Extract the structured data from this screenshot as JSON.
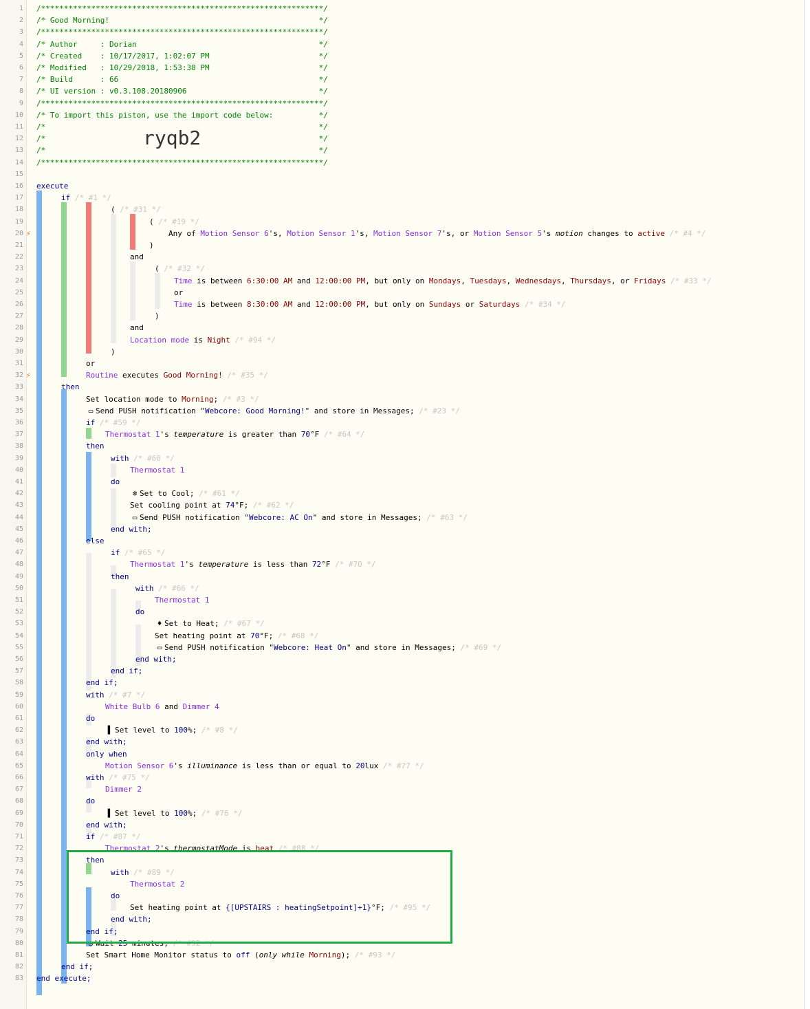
{
  "header": [
    "/**************************************************************/",
    "/* Good Morning!                                              */",
    "/**************************************************************/",
    "/* Author     : Dorian                                        */",
    "/* Created    : 10/17/2017, 1:02:07 PM                        */",
    "/* Modified   : 10/29/2018, 1:53:38 PM                        */",
    "/* Build      : 66                                            */",
    "/* UI version : v0.3.108.20180906                             */",
    "/**************************************************************/",
    "/* To import this piston, use the import code below:          */",
    "/*                                                            */",
    "/*                                                            */",
    "/*                                                            */",
    "/**************************************************************/"
  ],
  "import_code": "ryqb2",
  "code": {
    "execute": "execute",
    "if": "if",
    "c1": "/* #1 */",
    "c31": "/* #31 */",
    "c19": "/* #19 */",
    "line20_pre": "Any of ",
    "ms6": "Motion Sensor 6",
    "s_comma": "'s, ",
    "ms1": "Motion Sensor 1",
    "ms7": "Motion Sensor 7",
    "or_text": "'s, or ",
    "ms5": "Motion Sensor 5",
    "s_text": "'s ",
    "motion": "motion",
    "changes_to": " changes to ",
    "active": "active",
    "c4": "/* #4 */",
    "and": "and",
    "c32": "/* #32 */",
    "time": "Time",
    "is_between": " is between ",
    "t1": "6:30:00 AM",
    "and_sp": " and ",
    "t2": "12:00:00 PM",
    "but_only": ", but only on ",
    "mondays": "Mondays",
    "comma": ", ",
    "tuesdays": "Tuesdays",
    "wednesdays": "Wednesdays",
    "thursdays": "Thursdays",
    "comma_or": ", or ",
    "fridays": "Fridays",
    "c33": "/* #33 */",
    "or": "or",
    "t3": "8:30:00 AM",
    "sundays": "Sundays",
    "or_sp": " or ",
    "saturdays": "Saturdays",
    "c34": "/* #34 */",
    "location_mode": "Location mode",
    "is": " is ",
    "night": "Night",
    "c94": "/* #94 */",
    "routine": "Routine",
    "executes": " executes ",
    "good_morning": "Good Morning!",
    "c35": "/* #35 */",
    "then": "then",
    "set_loc_mode": "Set location mode to ",
    "morning": "Morning",
    "semi": ";",
    "c3": "/* #3 */",
    "send_push": "Send PUSH notification \"",
    "msg_gm": "Webcore: Good Morning!",
    "store": "\" and store in Messages;",
    "c23": "/* #23 */",
    "c59": "/* #59 */",
    "thermo1": "Thermostat 1",
    "temperature": "temperature",
    "greater": " is greater than ",
    "v70": "70",
    "degF": "°F",
    "c64": "/* #64 */",
    "with": "with",
    "c60": "/* #60 */",
    "do": "do",
    "set_cool": "Set to Cool;",
    "c61": "/* #61 */",
    "set_cool_pt": "Set cooling point at ",
    "v74": "74",
    "degF_semi": "°F;",
    "c62": "/* #62 */",
    "msg_ac": "Webcore: AC On",
    "c63": "/* #63 */",
    "end_with": "end with;",
    "else": "else",
    "c65": "/* #65 */",
    "less": " is less than ",
    "v72": "72",
    "c70": "/* #70 */",
    "c66": "/* #66 */",
    "set_heat": "Set to Heat;",
    "c67": "/* #67 */",
    "set_heat_pt": "Set heating point at ",
    "c68": "/* #68 */",
    "msg_heat": "Webcore: Heat On",
    "c69": "/* #69 */",
    "end_if": "end if;",
    "c7": "/* #7 */",
    "white_bulb": "White Bulb 6",
    "dimmer4": "Dimmer 4",
    "set_level": "Set level to ",
    "v100": "100",
    "pct": "%;",
    "c8": "/* #8 */",
    "only_when": "only when",
    "illuminance": "illuminance",
    "less_eq": " is less than or equal to ",
    "v20": "20",
    "lux": "lux",
    "c77": "/* #77 */",
    "c75": "/* #75 */",
    "dimmer2": "Dimmer 2",
    "c76": "/* #76 */",
    "c87": "/* #87 */",
    "thermo2": "Thermostat 2",
    "tmode": "thermostatMode",
    "heat": "heat",
    "c88": "/* #88 */",
    "c89": "/* #89 */",
    "expr": "{[UPSTAIRS : heatingSetpoint]+1}",
    "c95": "/* #95 */",
    "wait": "Wait ",
    "v25": "25",
    "minutes": " minutes;",
    "c92": "/* #92 */",
    "shm": "Set Smart Home Monitor status to ",
    "off": "off",
    "only_while": "only while ",
    "paren_open": " (",
    "paren_close": ");",
    "c93": "/* #93 */",
    "end_execute": "end execute;",
    "paren_l": "(",
    "paren_r": ")"
  },
  "icons": {
    "flag": "lightning-icon",
    "chat": "chat-bubble-icon",
    "snow": "snowflake-icon",
    "flame": "flame-icon",
    "signal": "signal-bars-icon",
    "clock": "clock-icon"
  },
  "colors": {
    "device": "#8a2be2",
    "value": "#8b0000",
    "keyword": "#00008b",
    "highlight_box": "#22aa44"
  }
}
